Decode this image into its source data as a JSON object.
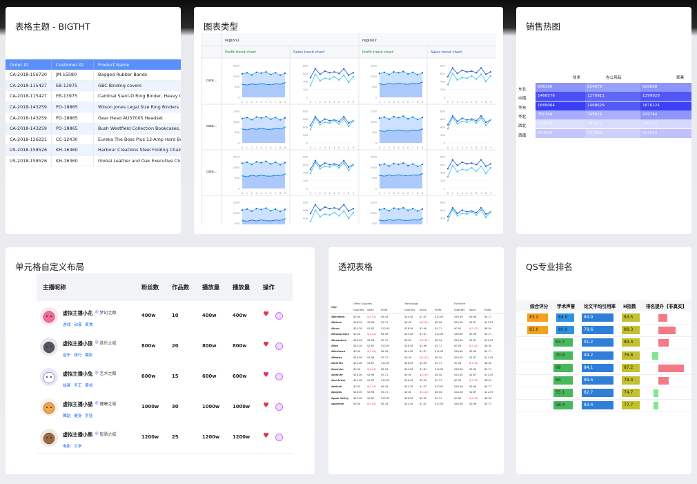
{
  "cards": {
    "table_theme": {
      "title": "表格主题 - BIGTHT",
      "columns": [
        "Order ID",
        "Customer ID",
        "Product Name"
      ],
      "rows": [
        [
          "CA-2018-156720",
          "JM-15580",
          "Bagged Rubber Bands"
        ],
        [
          "CA-2018-115427",
          "EB-13975",
          "GBC Binding covers"
        ],
        [
          "CA-2018-115427",
          "EB-13975",
          "Cardinal Slant-D Ring Binder, Heavy Gauge Vinyl"
        ],
        [
          "CA-2018-143259",
          "PO-18865",
          "Wilson Jones Legal Size Ring Binders"
        ],
        [
          "CA-2018-143259",
          "PO-18865",
          "Gear Head AU3700S Headset"
        ],
        [
          "CA-2018-143259",
          "PO-18865",
          "Bush Westfield Collection Bookcases, Fully Assembled"
        ],
        [
          "CA-2018-126221",
          "CC-12430",
          "Eureka The Boss Plus 12-Amp Hard Box Upright Vacuum"
        ],
        [
          "US-2018-158526",
          "KH-16360",
          "Harbour Creations Steel Folding Chair"
        ],
        [
          "US-2018-158526",
          "KH-16360",
          "Global Leather and Oak Executive Chair, Black"
        ]
      ]
    },
    "chart_types": {
      "title": "图表类型",
      "regions": [
        "region1",
        "region2"
      ],
      "chart_headers": [
        "Profit trend chart",
        "Sales trend chart",
        "Profit trend chart",
        "Sales trend chart"
      ],
      "row_label": "cate...",
      "area_yticks": [
        "1500",
        "1000",
        "500",
        "0"
      ],
      "line_yticks": [
        "800",
        "600",
        "400",
        "200",
        "0"
      ],
      "xticks": [
        "0",
        "1",
        "2",
        "3",
        "4",
        "5",
        "6",
        "7",
        "8",
        "9"
      ],
      "chart_data": {
        "type": "area",
        "x": [
          0,
          1,
          2,
          3,
          4,
          5,
          6,
          7,
          8,
          9
        ],
        "series": [
          {
            "values": [
              1150,
              1200,
              1100,
              1220,
              1180,
              1240,
              1120,
              1200,
              1090,
              1180
            ]
          },
          {
            "values": [
              620,
              580,
              640,
              600,
              650,
              610,
              600,
              640,
              620,
              700
            ]
          }
        ],
        "sales_series": [
          {
            "values": [
              480,
              700,
              560,
              640,
              600,
              620,
              580,
              700,
              540,
              600
            ]
          },
          {
            "values": [
              340,
              620,
              460,
              520,
              500,
              560,
              480,
              600,
              420,
              560
            ]
          }
        ],
        "ylim": [
          0,
          1500
        ],
        "sales_ylim": [
          0,
          800
        ]
      }
    },
    "sales_heatmap": {
      "title": "销售热图",
      "columns": [
        "技术",
        "办公用品",
        "家具"
      ],
      "rows": [
        {
          "label": "东北",
          "values": [
            "936190",
            "824673",
            "920698"
          ],
          "colors": [
            "#8c93fa",
            "#9aa1fb",
            "#8d94fa"
          ]
        },
        {
          "label": "中南",
          "values": [
            "1466576",
            "1270911",
            "1399928"
          ],
          "colors": [
            "#4a4ff7",
            "#6168f8",
            "#5157f7"
          ]
        },
        {
          "label": "华东",
          "values": [
            "1689064",
            "1408629",
            "1676224"
          ],
          "colors": [
            "#3a3ff5",
            "#545af7",
            "#3c41f5"
          ]
        },
        {
          "label": "华北",
          "values": [
            "781744",
            "745814",
            "919744"
          ],
          "colors": [
            "#a7acfb",
            "#abb0fb",
            "#8f96fa"
          ]
        },
        {
          "label": "西北",
          "values": [
            "230958",
            "267871",
            "296212"
          ],
          "colors": [
            "#dcdefd",
            "#d9dbfd",
            "#d6d8fd"
          ]
        },
        {
          "label": "西南",
          "values": [
            "453898",
            "347692",
            "501534"
          ],
          "colors": [
            "#c3c6fc",
            "#ced0fc",
            "#bec1fc"
          ]
        }
      ]
    },
    "custom_layout": {
      "title": "单元格自定义布局",
      "columns": [
        "主播昵称",
        "粉丝数",
        "作品数",
        "播放量",
        "播放量",
        "操作"
      ],
      "rows": [
        {
          "name": "虚拟主播小花",
          "city": "梦幻之都",
          "tags": [
            "游戏",
            "动漫",
            "美食"
          ],
          "fans": "400w",
          "works": "10",
          "plays": "400w",
          "plays2": "400w",
          "avatar": "flower-avatar",
          "color": "#ffe3e8"
        },
        {
          "name": "虚拟主播小狼",
          "city": "音乐之城",
          "tags": [
            "音乐",
            "旅行",
            "摄影"
          ],
          "fans": "800w",
          "works": "20",
          "plays": "800w",
          "plays2": "800w",
          "avatar": "wolf-avatar",
          "color": "#e8e8ec"
        },
        {
          "name": "虚拟主播小兔",
          "city": "艺术之都",
          "tags": [
            "绘画",
            "手工",
            "美妆"
          ],
          "fans": "600w",
          "works": "15",
          "plays": "600w",
          "plays2": "600w",
          "avatar": "rabbit-avatar",
          "color": "#ece5ff"
        },
        {
          "name": "虚拟主播小猫",
          "city": "健康之城",
          "tags": [
            "舞蹈",
            "健身",
            "烹饪"
          ],
          "fans": "1000w",
          "works": "30",
          "plays": "1000w",
          "plays2": "1000w",
          "avatar": "cat-avatar",
          "color": "#fff1df"
        },
        {
          "name": "虚拟主播小熊",
          "city": "智慧之城",
          "tags": [
            "电影",
            "文学"
          ],
          "fans": "1200w",
          "works": "25",
          "plays": "1200w",
          "plays2": "1200w",
          "avatar": "bear-avatar",
          "color": "#f3e7dc"
        }
      ]
    },
    "pivot_table": {
      "title": "透视表格",
      "groups": [
        "Office Supplies",
        "Technology",
        "Furniture"
      ],
      "subheaders": [
        "Quantity",
        "Sales",
        "Profit",
        "Quantity",
        "Sales",
        "Profit",
        "Quantity",
        "Sales",
        "Profit"
      ],
      "row_header": "City",
      "cities": [
        "Aberdeen",
        "Abilene",
        "Akron",
        "Albuquerque",
        "Alexandria",
        "Allen",
        "Allentown",
        "Altoona",
        "Amarillo",
        "Anaheim",
        "Andover",
        "Ann Arbor",
        "Antioch",
        "Apopka",
        "Apple Valley",
        "Appleton"
      ]
    },
    "qs_ranking": {
      "title": "QS专业排名",
      "columns": [
        "综合评分",
        "学术声誉",
        "论文平均引用率",
        "H指数",
        "排名提升【非真实】"
      ],
      "rows": [
        {
          "a": "83.2",
          "b": "84.9",
          "c": "84.9",
          "d": "83.5",
          "orange": true,
          "delta": 12
        },
        {
          "a": "83.0",
          "b": "80.9",
          "c": "79.6",
          "d": "88.3",
          "orange": true,
          "delta": 24
        },
        {
          "a": "",
          "b": "63.7",
          "c": "91.2",
          "d": "89.4",
          "orange": false,
          "delta": 14
        },
        {
          "a": "",
          "b": "70.9",
          "c": "94.2",
          "d": "76.8",
          "orange": false,
          "delta": -9
        },
        {
          "a": "",
          "b": "68",
          "c": "84.1",
          "d": "87.2",
          "orange": false,
          "delta": 35
        },
        {
          "a": "",
          "b": "64",
          "c": "89.6",
          "d": "78.4",
          "orange": false,
          "delta": 14
        },
        {
          "a": "",
          "b": "55.1",
          "c": "82.7",
          "d": "74.7",
          "orange": false,
          "delta": -7
        },
        {
          "a": "",
          "b": "58.4",
          "c": "83.4",
          "d": "77.7",
          "orange": false,
          "delta": -7
        }
      ]
    }
  }
}
